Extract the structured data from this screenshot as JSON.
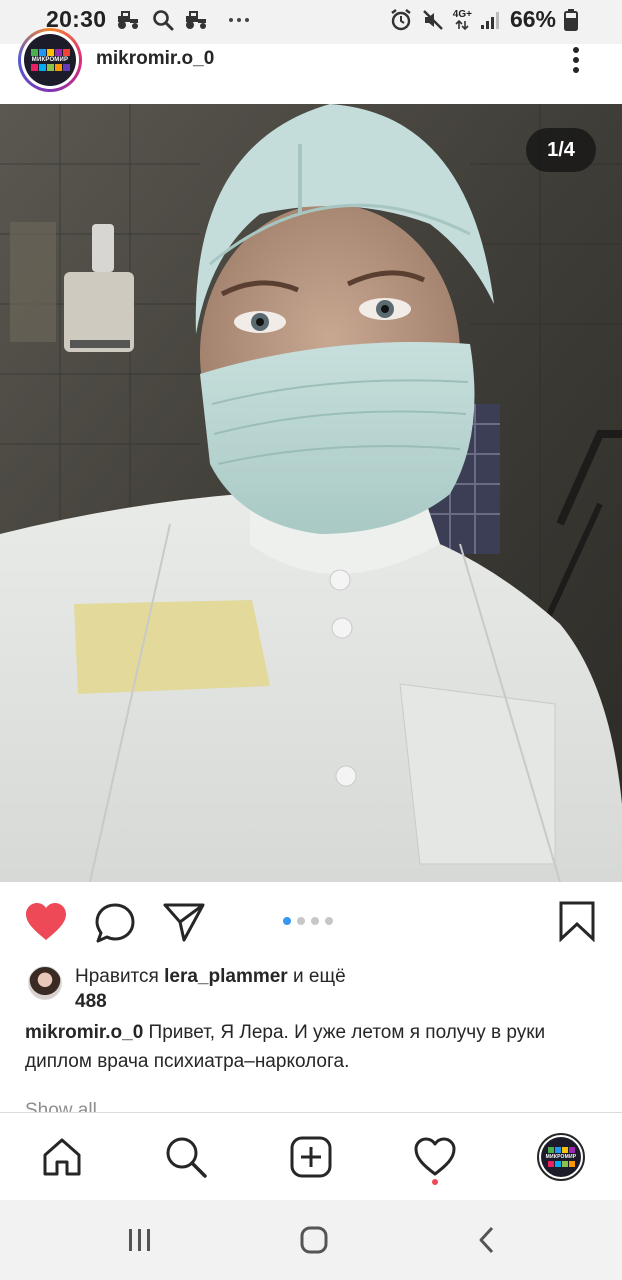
{
  "status_bar": {
    "time": "20:30",
    "network": "4G+",
    "battery": "66%"
  },
  "post": {
    "username": "mikromir.o_0",
    "avatar_logo_text": "МИКРОМИР",
    "page_counter": "1/4",
    "carousel": {
      "count": 4,
      "active_index": 0
    },
    "liked": true
  },
  "likes": {
    "prefix": "Нравится ",
    "user": "lera_plammer",
    "suffix": " и ещё",
    "count": "488"
  },
  "caption": {
    "username": "mikromir.o_0",
    "text": " Привет, Я Лера. И уже летом я получу в руки диплом врача психиатра–нарколога."
  },
  "show_all_partial": "Show all",
  "colors": {
    "like_red": "#ed4956",
    "carousel_active": "#3897f0",
    "text": "#262626"
  },
  "icons": {
    "status_left": [
      "tractor-icon",
      "search-icon",
      "tractor-icon",
      "more-dots-icon"
    ],
    "status_right": [
      "alarm-icon",
      "mute-icon",
      "signal-icon",
      "battery-icon"
    ],
    "actions": [
      "heart-filled-icon",
      "comment-icon",
      "share-icon",
      "bookmark-icon"
    ],
    "bottom_nav": [
      "home-icon",
      "search-icon",
      "add-post-icon",
      "activity-heart-icon",
      "profile-avatar"
    ],
    "system_nav": [
      "recents-icon",
      "home-button-icon",
      "back-icon"
    ]
  }
}
